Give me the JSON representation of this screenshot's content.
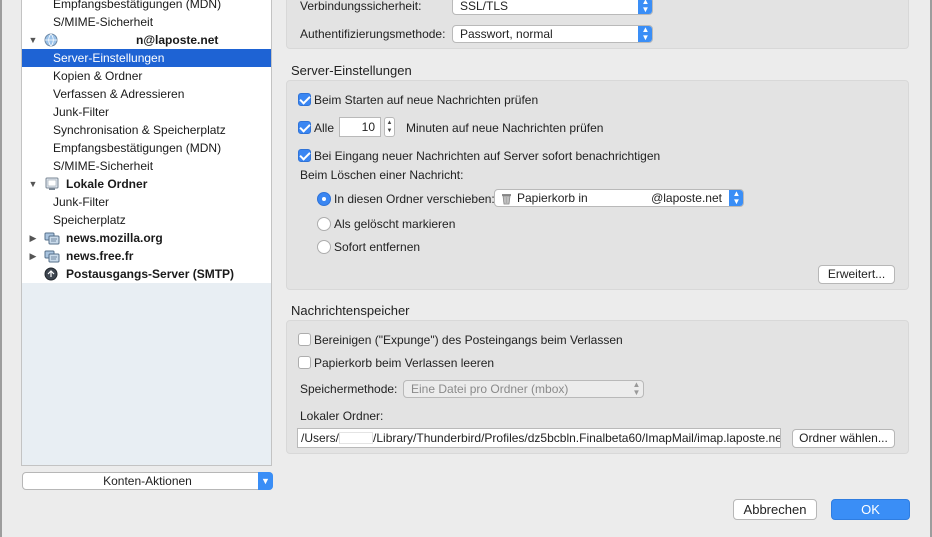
{
  "sidebar": {
    "rows": [
      {
        "label": "Empfangsbestätigungen (MDN)"
      },
      {
        "label": "S/MIME-Sicherheit"
      },
      {
        "label": "n@laposte.net"
      },
      {
        "label": "Server-Einstellungen"
      },
      {
        "label": "Kopien & Ordner"
      },
      {
        "label": "Verfassen & Adressieren"
      },
      {
        "label": "Junk-Filter"
      },
      {
        "label": "Synchronisation & Speicherplatz"
      },
      {
        "label": "Empfangsbestätigungen (MDN)"
      },
      {
        "label": "S/MIME-Sicherheit"
      },
      {
        "label": "Lokale Ordner"
      },
      {
        "label": "Junk-Filter"
      },
      {
        "label": "Speicherplatz"
      },
      {
        "label": "news.mozilla.org"
      },
      {
        "label": "news.free.fr"
      },
      {
        "label": "Postausgangs-Server (SMTP)"
      }
    ],
    "accounts_button": "Konten-Aktionen"
  },
  "security": {
    "connection_label": "Verbindungssicherheit:",
    "connection_value": "SSL/TLS",
    "auth_label": "Authentifizierungsmethode:",
    "auth_value": "Passwort, normal"
  },
  "server_settings": {
    "title": "Server-Einstellungen",
    "check_on_start": "Beim Starten auf neue Nachrichten prüfen",
    "every_label": "Alle",
    "every_value": "10",
    "minutes_label": "Minuten auf neue Nachrichten prüfen",
    "notify_label": "Bei Eingang neuer Nachrichten auf Server sofort benachrichtigen",
    "on_delete_label": "Beim Löschen einer Nachricht:",
    "move_to_label": "In diesen Ordner verschieben:",
    "trash_folder_prefix": "Papierkorb in",
    "trash_folder_suffix": "@laposte.net",
    "mark_deleted_label": "Als gelöscht markieren",
    "remove_now_label": "Sofort entfernen",
    "advanced_button": "Erweitert..."
  },
  "storage": {
    "title": "Nachrichtenspeicher",
    "expunge_label": "Bereinigen (\"Expunge\") des Posteingangs beim Verlassen",
    "empty_trash_label": "Papierkorb beim Verlassen leeren",
    "method_label": "Speichermethode:",
    "method_value": "Eine Datei pro Ordner (mbox)",
    "local_dir_label": "Lokaler Ordner:",
    "path_prefix": "/Users/",
    "path_suffix": "/Library/Thunderbird/Profiles/dz5bcbln.Finalbeta60/ImapMail/imap.laposte.ne",
    "choose_folder_button": "Ordner wählen..."
  },
  "footer": {
    "cancel_button": "Abbrechen",
    "ok_button": "OK"
  },
  "colors": {
    "accent": "#3a8ef6",
    "selection": "#1e63d4"
  }
}
